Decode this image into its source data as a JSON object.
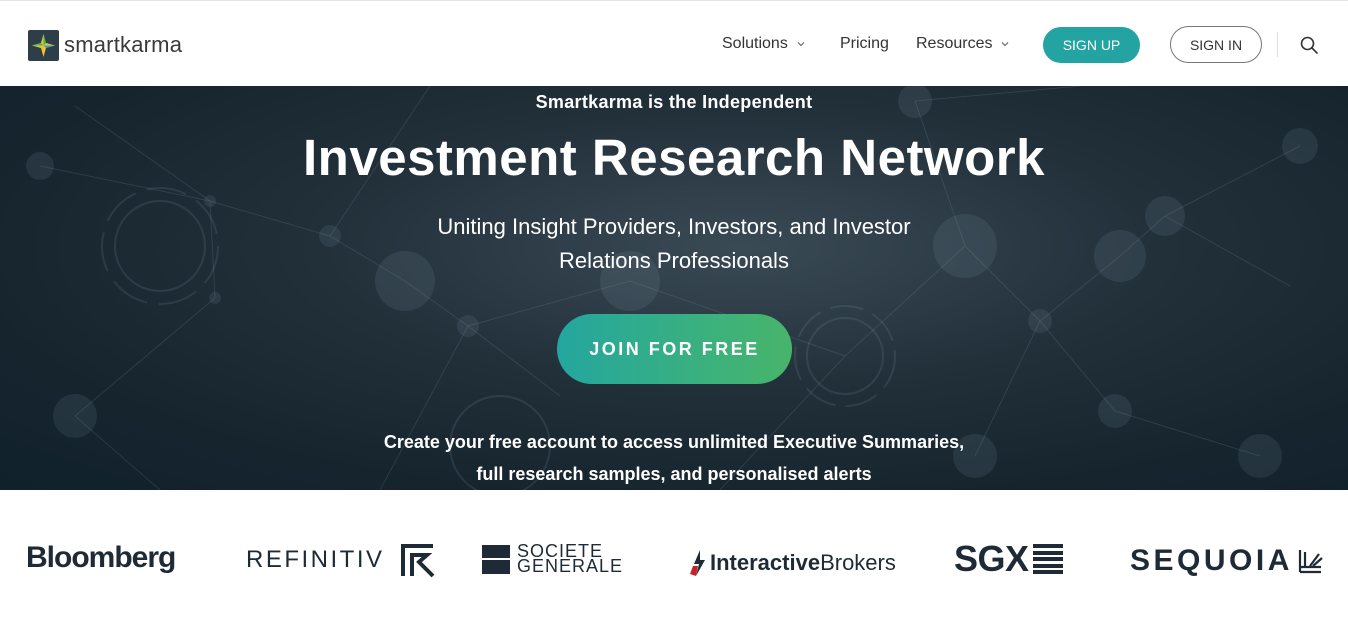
{
  "header": {
    "brand": "smartkarma",
    "nav": [
      {
        "label": "Solutions",
        "has_dropdown": true
      },
      {
        "label": "Pricing",
        "has_dropdown": false
      },
      {
        "label": "Resources",
        "has_dropdown": true
      }
    ],
    "signup_label": "SIGN UP",
    "signin_label": "SIGN IN",
    "search_icon": "search-icon"
  },
  "hero": {
    "eyebrow": "Smartkarma is the Independent",
    "title": "Investment Research Network",
    "subtitle": "Uniting Insight Providers, Investors, and Investor Relations Professionals",
    "cta_label": "JOIN FOR FREE",
    "cta_note": "Create your free account to access unlimited Executive Summaries, full research samples, and personalised alerts"
  },
  "partners": {
    "bloomberg": "Bloomberg",
    "refinitiv": "REFINITIV",
    "socgen_line1": "SOCIETE",
    "socgen_line2": "GENERALE",
    "ib_part1": "Interactive",
    "ib_part2": "Brokers",
    "sgx": "SGX",
    "sequoia": "SEQUOIA"
  },
  "colors": {
    "accent_teal": "#23a3a1",
    "cta_gradient_start": "#24a69f",
    "cta_gradient_end": "#48b46a",
    "hero_bg": "#1b2a34",
    "partner_text": "#1e2b37"
  }
}
